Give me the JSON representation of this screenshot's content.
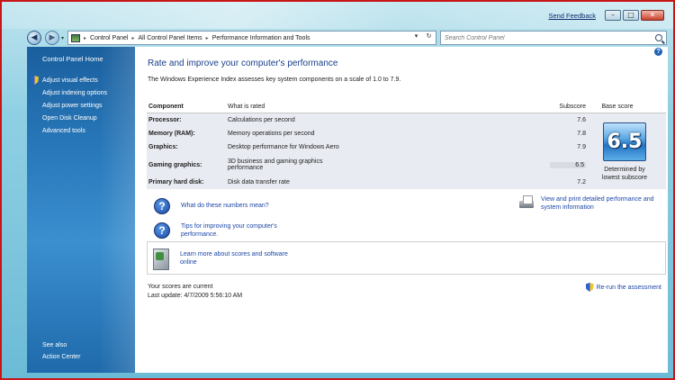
{
  "window": {
    "send_feedback": "Send Feedback",
    "minimize": "–",
    "maximize": "□",
    "close": "✕"
  },
  "nav": {
    "back": "◀",
    "forward": "▶",
    "dropdown": "▾",
    "breadcrumbs": [
      "Control Panel",
      "All Control Panel Items",
      "Performance Information and Tools"
    ],
    "refresh": "↻",
    "search_placeholder": "Search Control Panel"
  },
  "sidebar": {
    "home": "Control Panel Home",
    "links": [
      {
        "label": "Adjust visual effects",
        "icon": "shield-icon"
      },
      {
        "label": "Adjust indexing options"
      },
      {
        "label": "Adjust power settings"
      },
      {
        "label": "Open Disk Cleanup"
      },
      {
        "label": "Advanced tools"
      }
    ],
    "see_also": "See also",
    "action_center": "Action Center"
  },
  "main": {
    "help": "?",
    "title": "Rate and improve your computer's performance",
    "intro": "The Windows Experience Index assesses key system components on a scale of 1.0 to 7.9.",
    "headers": {
      "component": "Component",
      "rated": "What is rated",
      "subscore": "Subscore",
      "base": "Base score"
    },
    "rows": [
      {
        "component": "Processor:",
        "rated": "Calculations per second",
        "subscore": "7.6"
      },
      {
        "component": "Memory (RAM):",
        "rated": "Memory operations per second",
        "subscore": "7.8"
      },
      {
        "component": "Graphics:",
        "rated": "Desktop performance for Windows Aero",
        "subscore": "7.9"
      },
      {
        "component": "Gaming graphics:",
        "rated": "3D business and gaming graphics",
        "rated2": "performance",
        "subscore": "6.5"
      },
      {
        "component": "Primary hard disk:",
        "rated": "Disk data transfer rate",
        "subscore": "7.2"
      }
    ],
    "base_score": "6.5",
    "base_caption": "Determined by",
    "base_caption2": "lowest subscore",
    "help_links": {
      "numbers": "What do these numbers mean?",
      "tips": "Tips for improving your computer's",
      "tips2": "performance.",
      "print": "View and print detailed performance and",
      "print2": "system information"
    },
    "learn": {
      "line1": "Learn more about scores and software",
      "line2": "online"
    },
    "status": {
      "current": "Your scores are current",
      "last_update": "Last update: 4/7/2009 5:56:10 AM"
    },
    "rerun": "Re-run the assessment"
  }
}
